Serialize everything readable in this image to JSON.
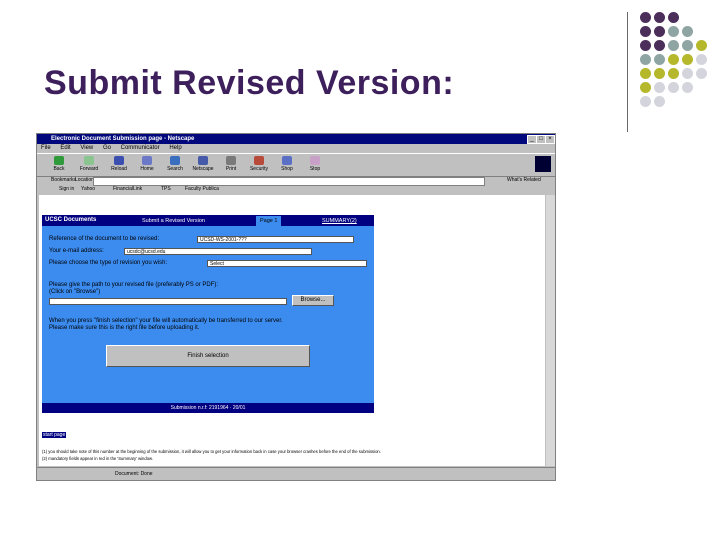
{
  "slide": {
    "title": "Submit Revised Version:"
  },
  "decoration": {
    "dot_colors": [
      "#4b2e5a",
      "#8fa5a4",
      "#b5b82a",
      "#d4d4dc"
    ]
  },
  "browser": {
    "window_title": "Electronic Document Submission page - Netscape",
    "menu": [
      "File",
      "Edit",
      "View",
      "Go",
      "Communicator",
      "Help"
    ],
    "toolbar": [
      "Back",
      "Forward",
      "Reload",
      "Home",
      "Search",
      "Netscape",
      "Print",
      "Security",
      "Shop",
      "Stop"
    ],
    "location_label": "Bookmarks",
    "location_sub": "Location:",
    "whats_related": "What's Related",
    "personal": [
      "Sign in",
      "Yahoo",
      "FinancialLink",
      "TPS",
      "Faculty Publica"
    ],
    "status": "Document: Done"
  },
  "page": {
    "brand": "UCSC Documents",
    "tabs": [
      "Submit a Revised Version",
      "Page 1",
      "SUMMARY(2)"
    ],
    "ref_label": "Reference of the document to be revised:",
    "ref_value": "UCSD-WS-2001-???",
    "email_label": "Your e-mail address:",
    "email_value": "ucsdc@ucsd.edu",
    "type_label": "Please choose the type of revision you wish:",
    "type_value": "Select",
    "path_label_1": "Please give the path to your revised file (preferably PS or PDF):",
    "path_label_2": "(Click on \"Browse\")",
    "browse_label": "Browse...",
    "finish_note_1": "When you press \"finish selection\" your file will automatically be transferred to our server.",
    "finish_note_2": "Please make sure this is the right file before uploading it.",
    "finish_button": "Finish selection",
    "footer": "Submission n.r.f: 2191964 · 20/01",
    "link": "start page",
    "note_1": "(1) you should take note of this number at the beginning of the submission, it will allow you to get your information back in case your browser crashes before the end of the submission.",
    "note_2": "(2) mandatory fields appear in red in the 'Summary' window."
  }
}
